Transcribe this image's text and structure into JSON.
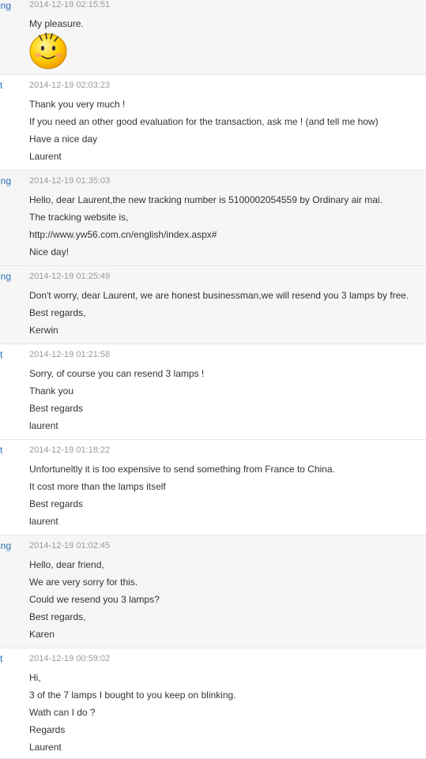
{
  "colors": {
    "sender": "#2a6ebb",
    "timestamp": "#999999",
    "text": "#333333",
    "row_alt": "#f6f6f6",
    "divider": "#e6e6e6"
  },
  "messages": [
    {
      "sender": "king",
      "time": "2014-12-19 02:15:51",
      "lines": [
        "My pleasure."
      ],
      "emoticon": "smiley-face-icon"
    },
    {
      "sender": "t",
      "time": "2014-12-19 02:03:23",
      "lines": [
        "Thank you very much !",
        "If you need an other good evaluation for the transaction, ask me ! (and tell me how)",
        "Have a nice day",
        "Laurent"
      ]
    },
    {
      "sender": "king",
      "time": "2014-12-19 01:35:03",
      "lines": [
        "Hello, dear Laurent,the new tracking number is 5100002054559  by Ordinary air mai.",
        "The tracking website is,",
        "http://www.yw56.com.cn/english/index.aspx#",
        "Nice day!"
      ]
    },
    {
      "sender": "king",
      "time": "2014-12-19 01:25:49",
      "lines": [
        "Don't worry, dear Laurent, we are honest businessman,we will resend you 3 lamps by free.",
        "Best regards,",
        "Kerwin"
      ]
    },
    {
      "sender": "t",
      "time": "2014-12-19 01:21:58",
      "lines": [
        "Sorry, of course you can resend 3 lamps !",
        "Thank you",
        "Best regards",
        "laurent"
      ]
    },
    {
      "sender": "t",
      "time": "2014-12-19 01:18:22",
      "lines": [
        "Unfortuneltly it is too expensive to send something from France to China.",
        "It cost more than the lamps itself",
        "Best regards",
        "laurent"
      ]
    },
    {
      "sender": "king",
      "time": "2014-12-19 01:02:45",
      "lines": [
        "Hello, dear friend,",
        "We are very sorry for this.",
        "Could we resend you 3 lamps?",
        "Best regards,",
        "Karen"
      ]
    },
    {
      "sender": "t",
      "time": "2014-12-19 00:59:02",
      "lines": [
        "Hi,",
        "3 of the 7 lamps I bought to you keep on blinking.",
        "Wath can I do ?",
        "Regards",
        "Laurent"
      ]
    }
  ]
}
